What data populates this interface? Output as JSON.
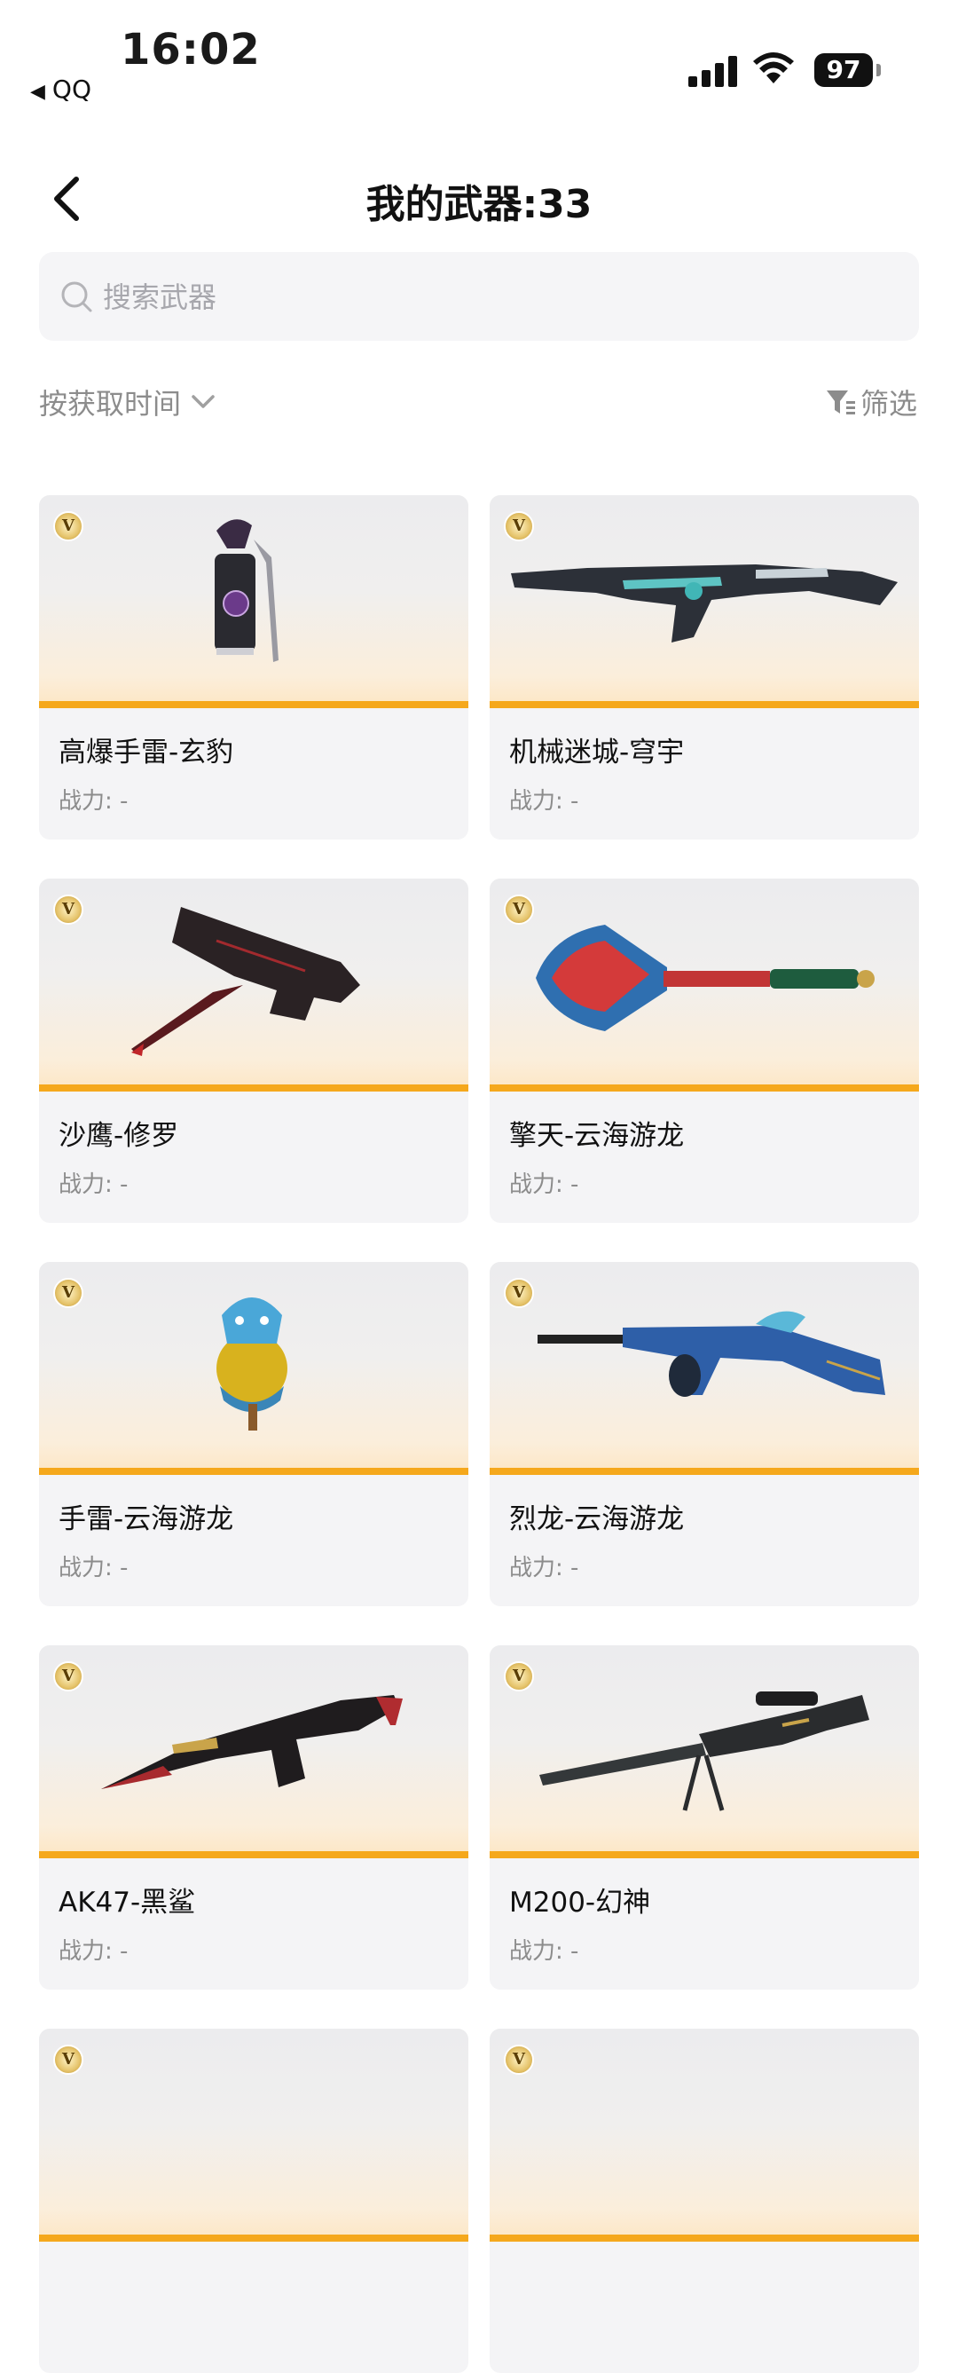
{
  "status_bar": {
    "time": "16:02",
    "back_app": "QQ",
    "battery": "97",
    "icons": [
      "signal-icon",
      "wifi-icon",
      "battery-icon"
    ]
  },
  "header": {
    "title": "我的武器:33",
    "back_icon": "chevron-left-icon"
  },
  "search": {
    "placeholder": "搜索武器",
    "value": ""
  },
  "toolbar": {
    "sort_label": "按获取时间",
    "filter_label": "筛选"
  },
  "accent_color": "#f5a81c",
  "badge_letter": "V",
  "weapons": [
    {
      "name": "高爆手雷-玄豹",
      "power": "战力: -",
      "icon": "grenade-icon"
    },
    {
      "name": "机械迷城-穹宇",
      "power": "战力: -",
      "icon": "rifle-icon"
    },
    {
      "name": "沙鹰-修罗",
      "power": "战力: -",
      "icon": "pistol-icon"
    },
    {
      "name": "擎天-云海游龙",
      "power": "战力: -",
      "icon": "melee-icon"
    },
    {
      "name": "手雷-云海游龙",
      "power": "战力: -",
      "icon": "dragon-grenade-icon"
    },
    {
      "name": "烈龙-云海游龙",
      "power": "战力: -",
      "icon": "smg-icon"
    },
    {
      "name": "AK47-黑鲨",
      "power": "战力: -",
      "icon": "ak47-icon"
    },
    {
      "name": "M200-幻神",
      "power": "战力: -",
      "icon": "sniper-icon"
    },
    {
      "name": "",
      "power": "",
      "icon": ""
    },
    {
      "name": "",
      "power": "",
      "icon": ""
    }
  ]
}
